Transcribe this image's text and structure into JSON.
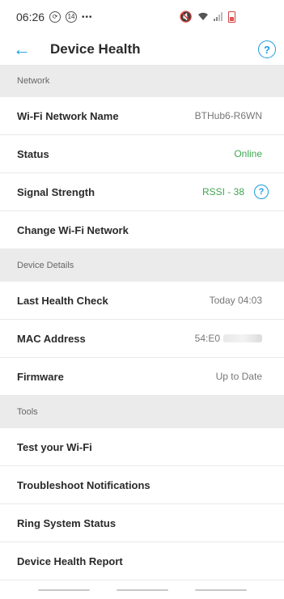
{
  "status_bar": {
    "time": "06:26",
    "badge": "14",
    "dots": "•••"
  },
  "header": {
    "title": "Device Health",
    "back_icon": "arrow-left-icon",
    "help_icon": "question-circle-icon",
    "help_glyph": "?"
  },
  "sections": {
    "network": {
      "title": "Network",
      "wifi_name_label": "Wi-Fi Network Name",
      "wifi_name_value": "BTHub6-R6WN",
      "status_label": "Status",
      "status_value": "Online",
      "signal_label": "Signal Strength",
      "signal_value": "RSSI - 38",
      "change_wifi_label": "Change Wi-Fi Network"
    },
    "device_details": {
      "title": "Device Details",
      "last_check_label": "Last Health Check",
      "last_check_value": "Today 04:03",
      "mac_label": "MAC Address",
      "mac_value": "54:E0",
      "firmware_label": "Firmware",
      "firmware_value": "Up to Date"
    },
    "tools": {
      "title": "Tools",
      "items": [
        "Test your Wi-Fi",
        "Troubleshoot Notifications",
        "Ring System Status",
        "Device Health Report"
      ]
    }
  },
  "colors": {
    "accent": "#1a9be0",
    "online_green": "#3ea650",
    "section_bg": "#ebebeb"
  }
}
